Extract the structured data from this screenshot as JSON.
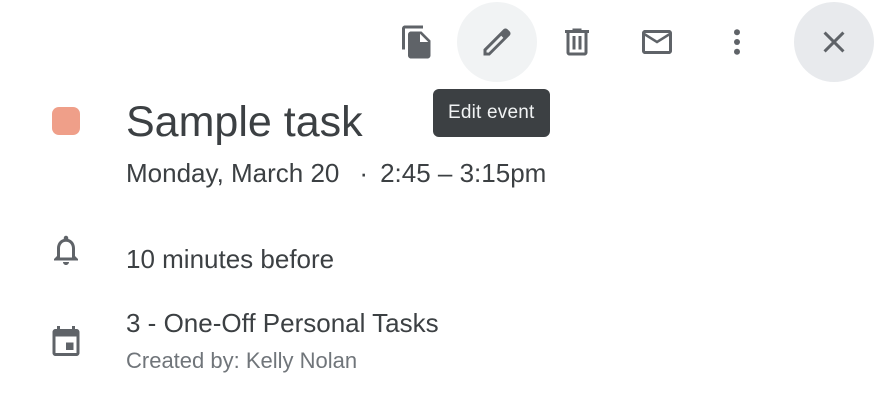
{
  "toolbar": {
    "buttons": [
      {
        "icon": "duplicate-icon"
      },
      {
        "icon": "edit-icon"
      },
      {
        "icon": "delete-icon"
      },
      {
        "icon": "email-icon"
      },
      {
        "icon": "more-options-icon"
      },
      {
        "icon": "close-icon"
      }
    ],
    "tooltip": "Edit event"
  },
  "event": {
    "color": "#ef9f89",
    "title": "Sample task",
    "date": "Monday, March 20",
    "separator": "·",
    "time": "2:45 – 3:15pm",
    "reminder": "10 minutes before",
    "calendar": "3 - One-Off Personal Tasks",
    "created_by": "Created by: Kelly Nolan"
  },
  "colors": {
    "icon": "#5f6368",
    "text": "#3c4043",
    "secondary_text": "#70757a",
    "hover_bg": "#f1f3f4",
    "close_bg": "#e8eaed",
    "tooltip_bg": "#3c4043"
  }
}
